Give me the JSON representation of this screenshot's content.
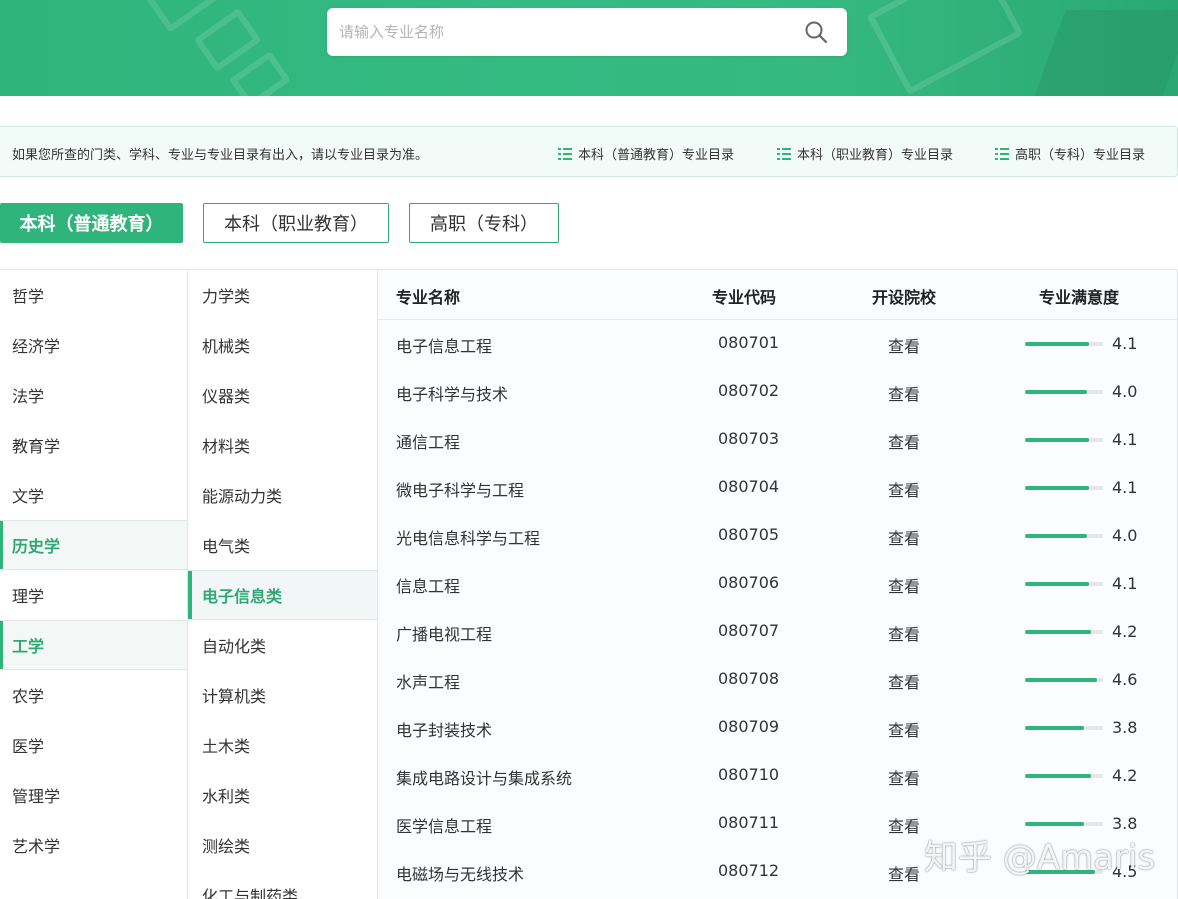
{
  "search": {
    "placeholder": "请输入专业名称"
  },
  "notice": {
    "text": "如果您所查的门类、学科、专业与专业目录有出入，请以专业目录为准。",
    "links": [
      "本科（普通教育）专业目录",
      "本科（职业教育）专业目录",
      "高职（专科）专业目录"
    ]
  },
  "tabs": [
    "本科（普通教育）",
    "本科（职业教育）",
    "高职（专科）"
  ],
  "categories": [
    "哲学",
    "经济学",
    "法学",
    "教育学",
    "文学",
    "历史学",
    "理学",
    "工学",
    "农学",
    "医学",
    "管理学",
    "艺术学"
  ],
  "subcategories": [
    "力学类",
    "机械类",
    "仪器类",
    "材料类",
    "能源动力类",
    "电气类",
    "电子信息类",
    "自动化类",
    "计算机类",
    "土木类",
    "水利类",
    "测绘类",
    "化工与制药类"
  ],
  "table": {
    "headers": {
      "name": "专业名称",
      "code": "专业代码",
      "schools": "开设院校",
      "satisfaction": "专业满意度"
    },
    "rows": [
      {
        "name": "电子信息工程",
        "code": "080701",
        "view": "查看",
        "score": "4.1"
      },
      {
        "name": "电子科学与技术",
        "code": "080702",
        "view": "查看",
        "score": "4.0"
      },
      {
        "name": "通信工程",
        "code": "080703",
        "view": "查看",
        "score": "4.1"
      },
      {
        "name": "微电子科学与工程",
        "code": "080704",
        "view": "查看",
        "score": "4.1"
      },
      {
        "name": "光电信息科学与工程",
        "code": "080705",
        "view": "查看",
        "score": "4.0"
      },
      {
        "name": "信息工程",
        "code": "080706",
        "view": "查看",
        "score": "4.1"
      },
      {
        "name": "广播电视工程",
        "code": "080707",
        "view": "查看",
        "score": "4.2"
      },
      {
        "name": "水声工程",
        "code": "080708",
        "view": "查看",
        "score": "4.6"
      },
      {
        "name": "电子封装技术",
        "code": "080709",
        "view": "查看",
        "score": "3.8"
      },
      {
        "name": "集成电路设计与集成系统",
        "code": "080710",
        "view": "查看",
        "score": "4.2"
      },
      {
        "name": "医学信息工程",
        "code": "080711",
        "view": "查看",
        "score": "3.8"
      },
      {
        "name": "电磁场与无线技术",
        "code": "080712",
        "view": "查看",
        "score": "4.5"
      }
    ]
  },
  "watermark": "知乎 @Amaris",
  "colors": {
    "accent": "#2fb47c",
    "banner": "#34bb82",
    "notice_bg": "#f2fbf7"
  }
}
